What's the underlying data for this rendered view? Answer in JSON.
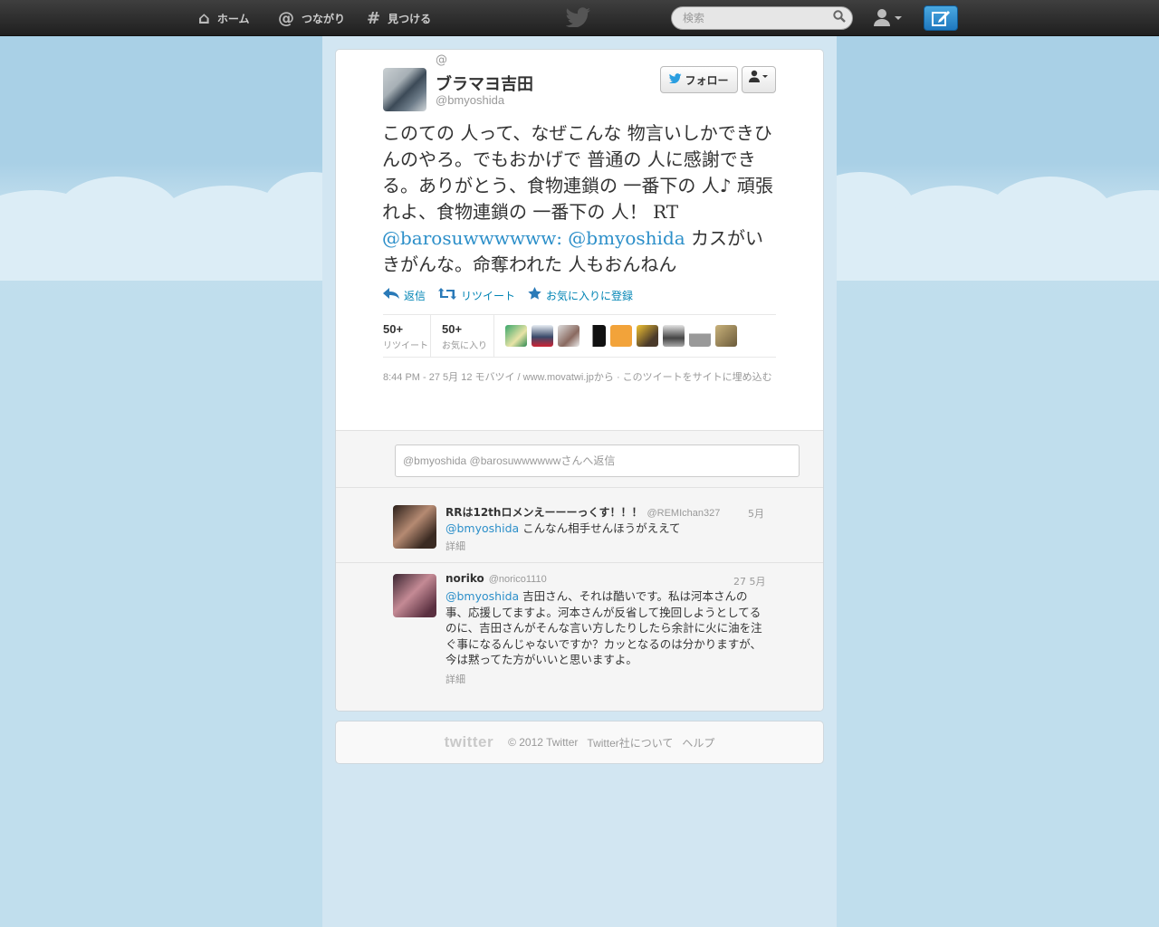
{
  "colors": {
    "background": "#c0deed",
    "topbar": "#2b2b2b",
    "link": "#2c8fc9",
    "compose_button": "#2f8fd3"
  },
  "nav": {
    "home": {
      "label": "ホーム",
      "icon": "home-icon"
    },
    "connect": {
      "label": "つながり",
      "icon": "at-icon"
    },
    "discover": {
      "label": "見つける",
      "icon": "hashtag-icon"
    },
    "logo_icon": "twitter-bird-icon",
    "search_placeholder": "検索",
    "user_menu_icon": "user-icon",
    "compose_icon": "compose-icon"
  },
  "tweet": {
    "at_symbol": "@",
    "user": {
      "fullname": "ブラマヨ吉田",
      "screen_name": "@bmyoshida"
    },
    "follow_label": "フォロー",
    "text_before": "このての 人って、なぜこんな 物言いしかできひんのやろ。でもおかげで 普通の 人に感謝できる。ありがとう、食物連鎖の 一番下の 人♪ 頑張れよ、食物連鎖の 一番下の 人！ RT ",
    "mention1": "@barosuwwwwww:",
    "mention2": "@bmyoshida",
    "text_after": " カスがいきがんな。命奪われた 人もおんねん",
    "actions": {
      "reply": "返信",
      "retweet": "リツイート",
      "favorite": "お気に入りに登録"
    },
    "stats": {
      "retweets_count": "50+",
      "retweets_label": "リツイート",
      "favorites_count": "50+",
      "favorites_label": "お気に入り"
    },
    "meta": "8:44 PM - 27 5月 12 モバツイ / www.movatwi.jpから · このツイートをサイトに埋め込む"
  },
  "reply_box": {
    "placeholder": "@bmyoshida @barosuwwwwwwさんへ返信"
  },
  "replies": [
    {
      "name": "RRは12thロメンえーーーっくす！！！",
      "handle": "@REMIchan327",
      "date": "5月",
      "mention": "@bmyoshida",
      "text": " こんなん相手せんほうがええて",
      "detail": "詳細"
    },
    {
      "name": "noriko",
      "handle": "@norico1110",
      "date": "27 5月",
      "mention": "@bmyoshida",
      "text": " 吉田さん、それは酷いです。私は河本さんの事、応援してますよ。河本さんが反省して挽回しようとしてるのに、吉田さんがそんな言い方したりしたら余計に火に油を注ぐ事になるんじゃないですか？カッとなるのは分かりますが、今は黙ってた方がいいと思いますよ。",
      "detail": "詳細"
    }
  ],
  "footer": {
    "logo": "twitter",
    "copyright": "© 2012 Twitter",
    "about": "Twitter社について",
    "help": "ヘルプ"
  }
}
